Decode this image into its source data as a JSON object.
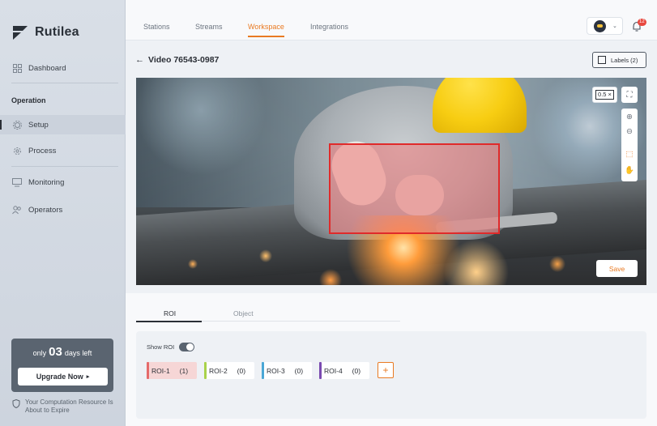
{
  "app": {
    "name": "Rutilea"
  },
  "sidebar": {
    "dashboard": "Dashboard",
    "section": "Operation",
    "items": [
      {
        "label": "Setup",
        "icon": "setup-icon"
      },
      {
        "label": "Process",
        "icon": "process-icon"
      },
      {
        "label": "Monitoring",
        "icon": "monitoring-icon"
      },
      {
        "label": "Operators",
        "icon": "operators-icon"
      }
    ],
    "trial": {
      "prefix": "only",
      "days": "03",
      "suffix": "days left",
      "button": "Upgrade Now",
      "note": "Your Computation Resource Is About to Expire"
    }
  },
  "topbar": {
    "tabs": [
      "Stations",
      "Streams",
      "Workspace",
      "Integrations"
    ],
    "active_tab": "Workspace",
    "notification_count": "12"
  },
  "workspace": {
    "title": "Video 76543-0987",
    "labels_button": "Labels (2)",
    "zoom": "0.5 ×",
    "save": "Save",
    "lower_tabs": [
      "ROI",
      "Object"
    ],
    "show_roi_label": "Show ROI",
    "show_roi_enabled": true,
    "rois": [
      {
        "label": "ROI-1",
        "count": "(1)",
        "color": "#e56a6a",
        "bg": "#f6d6d6"
      },
      {
        "label": "ROI-2",
        "count": "(0)",
        "color": "#a9d24a",
        "bg": "#ffffff"
      },
      {
        "label": "ROI-3",
        "count": "(0)",
        "color": "#4aa7d6",
        "bg": "#ffffff"
      },
      {
        "label": "ROI-4",
        "count": "(0)",
        "color": "#7a4ab0",
        "bg": "#ffffff"
      }
    ],
    "add_label": "+"
  },
  "colors": {
    "accent": "#e97a22",
    "roi_border": "#e02a2a"
  }
}
